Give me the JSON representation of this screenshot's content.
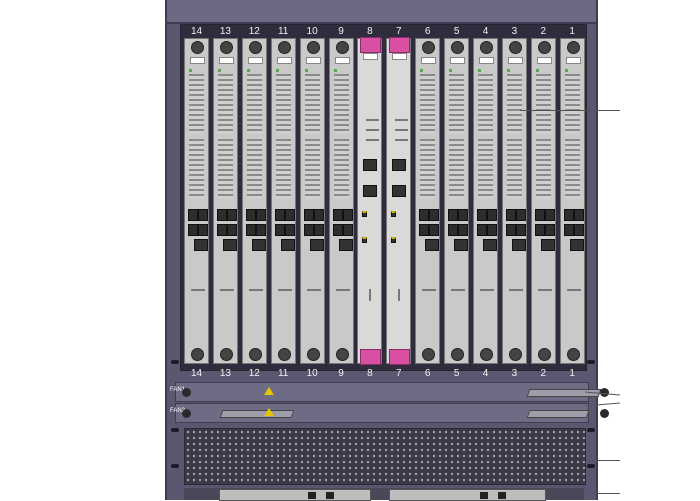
{
  "slots": [
    "14",
    "13",
    "12",
    "11",
    "10",
    "9",
    "8",
    "7",
    "6",
    "5",
    "4",
    "3",
    "2",
    "1"
  ],
  "main_slots": [
    "8",
    "7"
  ],
  "fan_labels": [
    "FAN1",
    "FAN2"
  ]
}
